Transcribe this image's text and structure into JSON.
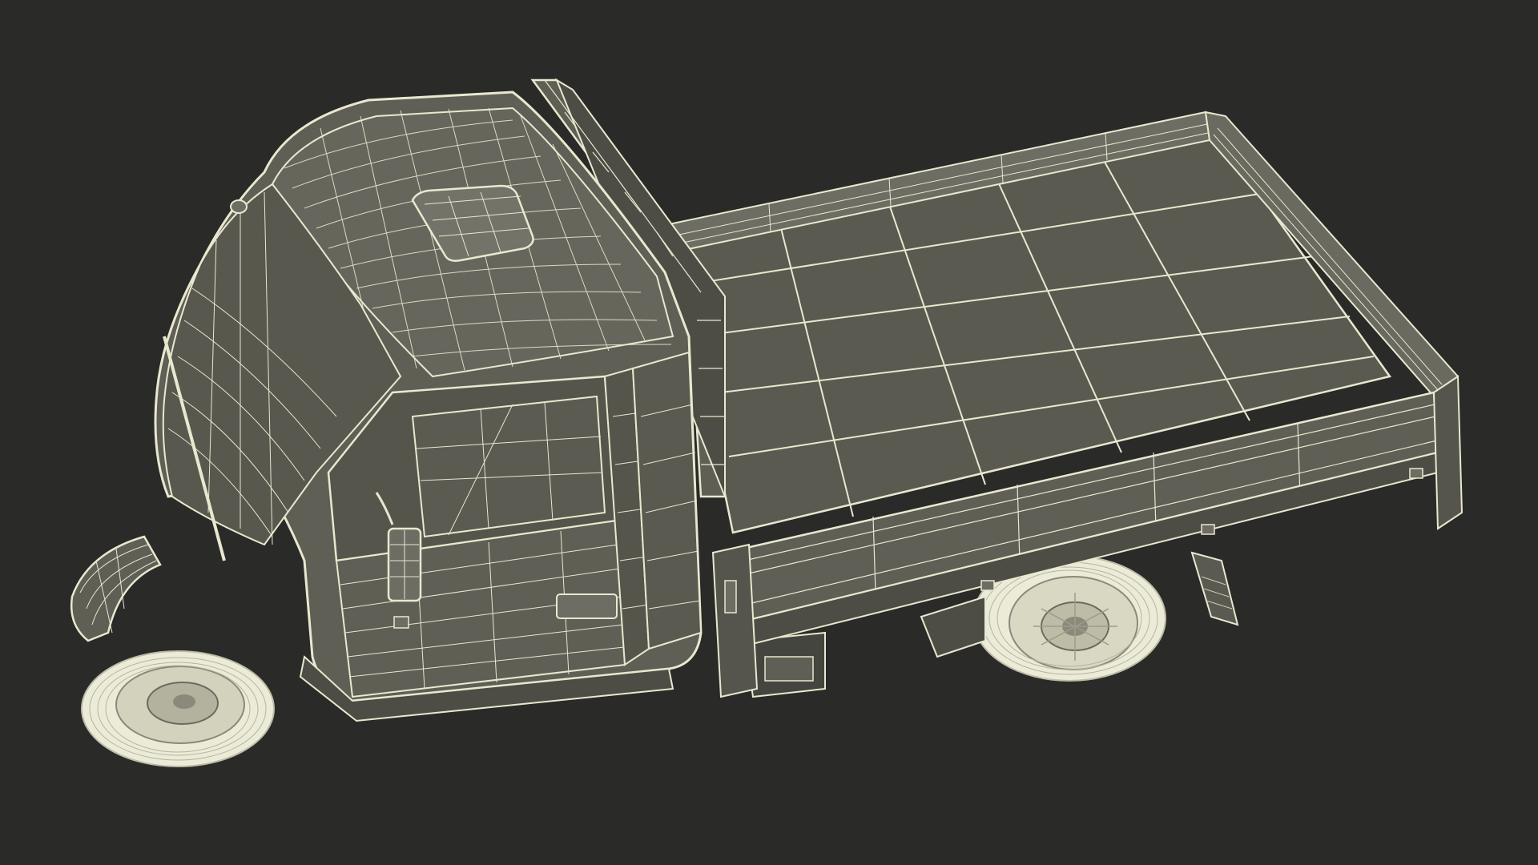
{
  "scene": {
    "subject": "three-wheel-flatbed-truck-wireframe",
    "colors": {
      "background": "#2a2a29",
      "surface": "#5f5f56",
      "surface_dark": "#4d4d46",
      "surface_light": "#6d6d63",
      "wire": "#e9e8cf",
      "wire_dim": "#cfcdb5",
      "tire": "#ecebd8"
    }
  }
}
